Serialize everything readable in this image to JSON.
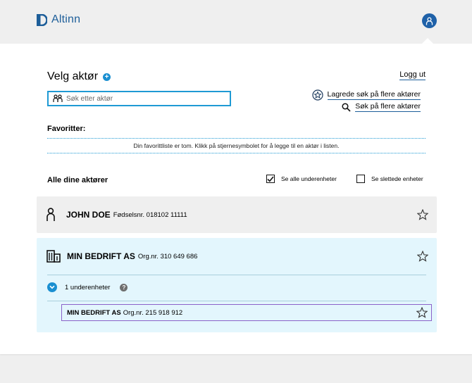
{
  "header": {
    "logo_text": "Altinn",
    "brand_color": "#1d5e99"
  },
  "main": {
    "title": "Velg aktør",
    "logout_label": "Logg ut",
    "search_placeholder": "Søk etter aktør",
    "links": [
      {
        "label": "Lagrede søk på flere aktører",
        "icon": "star-circle-icon"
      },
      {
        "label": "Søk på flere aktører",
        "icon": "search-icon"
      }
    ],
    "favorites": {
      "title": "Favoritter:",
      "empty_message": "Din favorittliste er tom. Klikk på stjernesymbolet for å legge til en aktør i listen."
    },
    "all": {
      "title": "Alle dine aktører",
      "show_subunits_label": "Se alle underenheter",
      "show_subunits_checked": true,
      "show_deleted_label": "Se slettede enheter",
      "show_deleted_checked": false
    },
    "actors": [
      {
        "name": "JOHN DOE",
        "id_label": "Fødselsnr. 018102 11111",
        "type": "person"
      },
      {
        "name": "MIN BEDRIFT AS",
        "id_label": "Org.nr. 310 649 686",
        "type": "organization",
        "subunits_label": "1 underenheter",
        "help": "?",
        "subunits": [
          {
            "name": "MIN BEDRIFT AS",
            "id_label": "Org.nr. 215 918 912"
          }
        ]
      }
    ]
  },
  "colors": {
    "accent": "#1a8fd1",
    "org_background": "#e3f6fd",
    "selected_border": "#8a62c9"
  }
}
